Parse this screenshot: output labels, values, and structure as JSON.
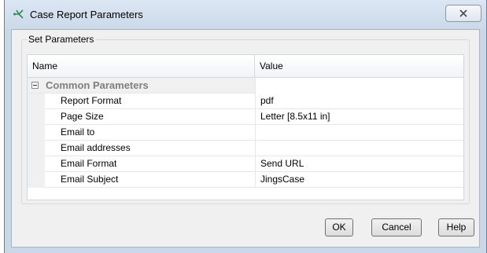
{
  "window": {
    "title": "Case Report Parameters",
    "title_icon": "hierarchy-node-icon",
    "close_icon": "close-x-icon"
  },
  "group": {
    "legend": "Set Parameters"
  },
  "grid": {
    "columns": {
      "name": "Name",
      "value": "Value"
    },
    "category": {
      "label": "Common Parameters",
      "expanded": true
    },
    "rows": [
      {
        "name": "Report Format",
        "value": "pdf"
      },
      {
        "name": "Page Size",
        "value": "Letter [8.5x11 in]"
      },
      {
        "name": "Email to",
        "value": ""
      },
      {
        "name": "Email addresses",
        "value": ""
      },
      {
        "name": "Email Format",
        "value": "Send URL"
      },
      {
        "name": "Email Subject",
        "value": "JingsCase"
      }
    ]
  },
  "buttons": {
    "ok": "OK",
    "cancel": "Cancel",
    "help": "Help"
  },
  "colors": {
    "frame": "#c9d7e6",
    "client_bg": "#f0f0f0",
    "category_text": "#7f7f7f",
    "icon_green": "#2e8b57"
  }
}
